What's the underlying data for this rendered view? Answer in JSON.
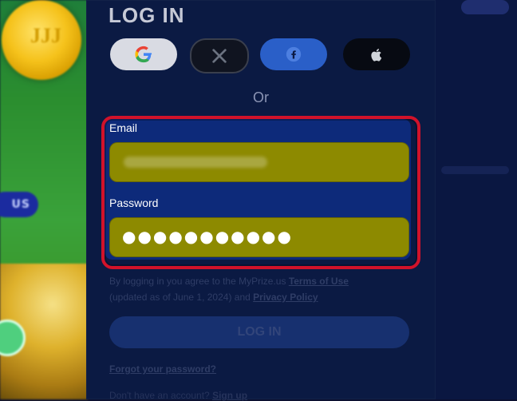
{
  "login": {
    "title": "LOG IN",
    "social": {
      "buttons": [
        {
          "name": "google",
          "icon": "google-icon"
        },
        {
          "name": "x",
          "icon": "x-icon"
        },
        {
          "name": "facebook",
          "icon": "facebook-icon"
        },
        {
          "name": "apple",
          "icon": "apple-icon"
        }
      ]
    },
    "or_text": "Or",
    "email": {
      "label": "Email",
      "value": ""
    },
    "password": {
      "label": "Password",
      "value_masked": "●●●●●●●●●●●"
    },
    "legal": {
      "prefix": "By logging in you agree to the MyPrize.us",
      "terms_link": "Terms of Use",
      "middle": "(updated as of June 1, 2024) and",
      "privacy_link": "Privacy Policy"
    },
    "login_button": "LOG IN",
    "forgot_password": "Forgot your password?",
    "signup": {
      "prefix": "Don't have an account?",
      "link": "Sign up"
    }
  },
  "background": {
    "left_badge": "US",
    "coin_mark": "JJJ"
  },
  "colors": {
    "modal_bg": "#0b1a43",
    "highlight_border": "#d1122a",
    "field_fill": "#8d8a00",
    "google_btn_bg": "#d9dbe3",
    "facebook_btn_bg": "#2a5fc8",
    "x_btn_bg": "#101420",
    "apple_btn_bg": "#070a12"
  }
}
